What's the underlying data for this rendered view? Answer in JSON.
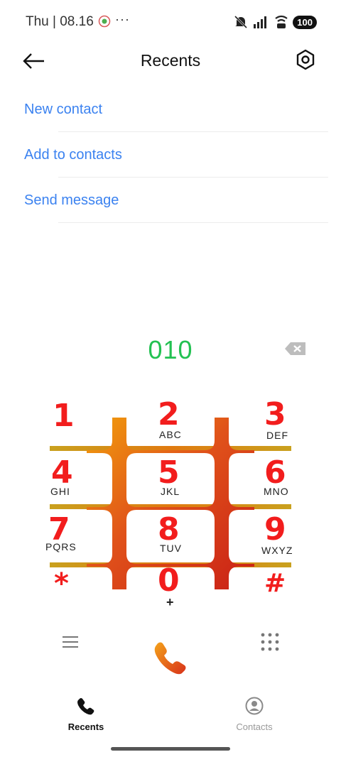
{
  "status_bar": {
    "time": "Thu | 08.16",
    "more": "···",
    "battery": "100"
  },
  "header": {
    "title": "Recents"
  },
  "actions": [
    {
      "label": "New contact"
    },
    {
      "label": "Add to contacts"
    },
    {
      "label": "Send message"
    }
  ],
  "dialer": {
    "number": "010"
  },
  "keypad": [
    {
      "digit": "1",
      "letters": ""
    },
    {
      "digit": "2",
      "letters": "ABC"
    },
    {
      "digit": "3",
      "letters": "DEF"
    },
    {
      "digit": "4",
      "letters": "GHI"
    },
    {
      "digit": "5",
      "letters": "JKL"
    },
    {
      "digit": "6",
      "letters": "MNO"
    },
    {
      "digit": "7",
      "letters": "PQRS"
    },
    {
      "digit": "8",
      "letters": "TUV"
    },
    {
      "digit": "9",
      "letters": "WXYZ"
    },
    {
      "digit": "*",
      "letters": ""
    },
    {
      "digit": "0",
      "letters": "+"
    },
    {
      "digit": "#",
      "letters": ""
    }
  ],
  "nav": {
    "recents": "Recents",
    "contacts": "Contacts"
  },
  "colors": {
    "accent": "#3b82f0",
    "number": "#23c152",
    "key_digit": "#f21d1d",
    "frame_dark": "#d6321a",
    "frame_light": "#f08a0e"
  },
  "icons": {
    "back": "back-arrow-icon",
    "settings": "hexagon-settings-icon",
    "backspace": "backspace-icon",
    "menu": "hamburger-menu-icon",
    "dialpad": "dialpad-grid-icon",
    "call": "phone-call-icon",
    "recents": "phone-icon",
    "contacts": "person-circle-icon"
  }
}
